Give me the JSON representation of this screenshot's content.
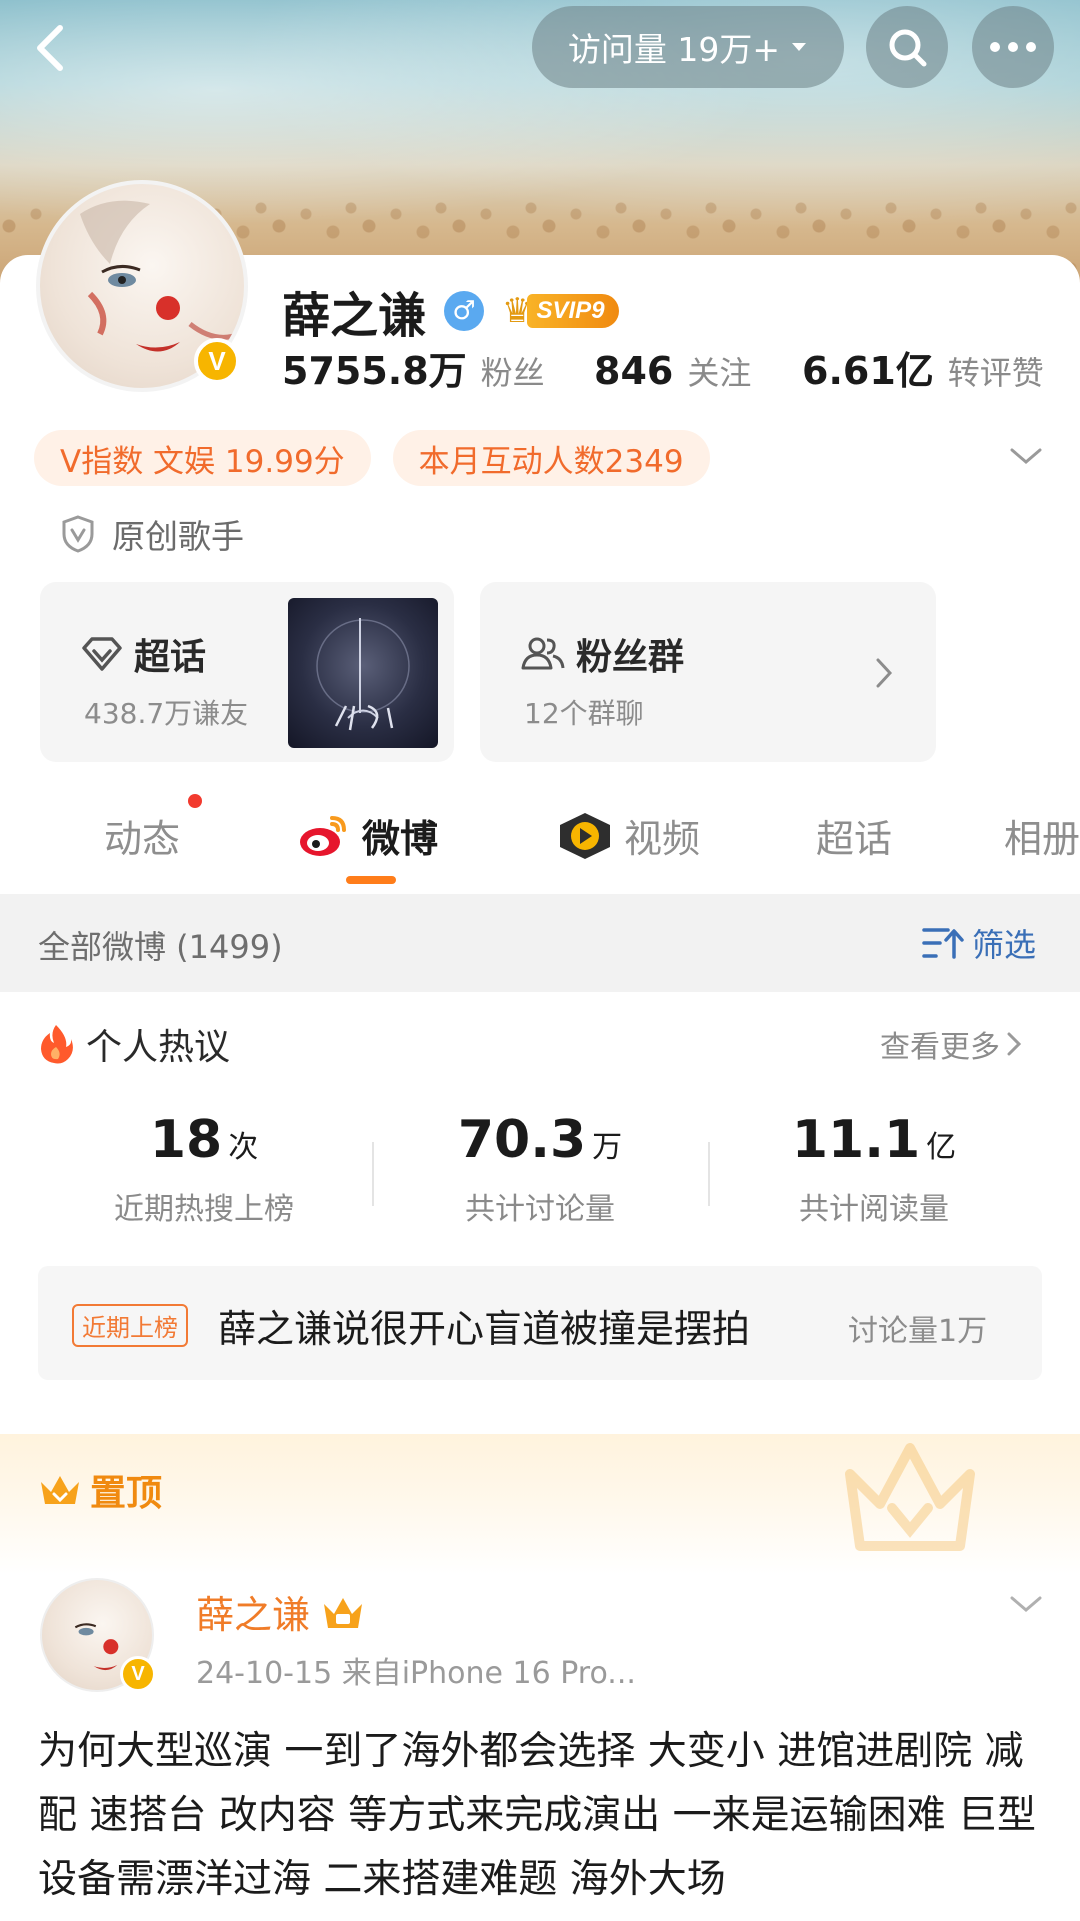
{
  "header": {
    "visit_label": "访问量 19万+"
  },
  "profile": {
    "name": "薛之谦",
    "gender_symbol": "♂",
    "vip_label": "SVIP9",
    "verified_mark": "V",
    "stats": [
      {
        "num": "5755.8万",
        "label": "粉丝"
      },
      {
        "num": "846",
        "label": "关注"
      },
      {
        "num": "6.61亿",
        "label": "转评赞"
      }
    ],
    "tags": [
      "V指数 文娱 19.99分",
      "本月互动人数2349"
    ],
    "verification": "原创歌手"
  },
  "features": {
    "supertopic": {
      "title": "超话",
      "subtitle": "438.7万谦友"
    },
    "fan_group": {
      "title": "粉丝群",
      "subtitle": "12个群聊"
    }
  },
  "tabs": [
    "动态",
    "微博",
    "视频",
    "超话",
    "相册"
  ],
  "filter": {
    "count_label": "全部微博 (1499)",
    "filter_label": "筛选"
  },
  "hot": {
    "title": "个人热议",
    "more": "查看更多",
    "stats": [
      {
        "big": "18",
        "unit": "次",
        "desc": "近期热搜上榜"
      },
      {
        "big": "70.3",
        "unit": "万",
        "desc": "共计讨论量"
      },
      {
        "big": "11.1",
        "unit": "亿",
        "desc": "共计阅读量"
      }
    ],
    "item": {
      "badge": "近期上榜",
      "text": "薛之谦说很开心盲道被撞是摆拍",
      "discussion": "讨论量1万"
    }
  },
  "pinned": {
    "label": "置顶"
  },
  "post": {
    "author": "薛之谦",
    "meta": "24-10-15  来自iPhone 16 Pro...",
    "text": "为何大型巡演 一到了海外都会选择 大变小 进馆进剧院 减配 速搭台 改内容 等方式来完成演出 一来是运输困难 巨型设备需漂洋过海 二来搭建难题 海外大场"
  },
  "colors": {
    "accent_orange": "#ff7d1a",
    "tag_text": "#f16b2c",
    "link_blue": "#3a6fb7",
    "vip_gold": "#f7b500"
  }
}
